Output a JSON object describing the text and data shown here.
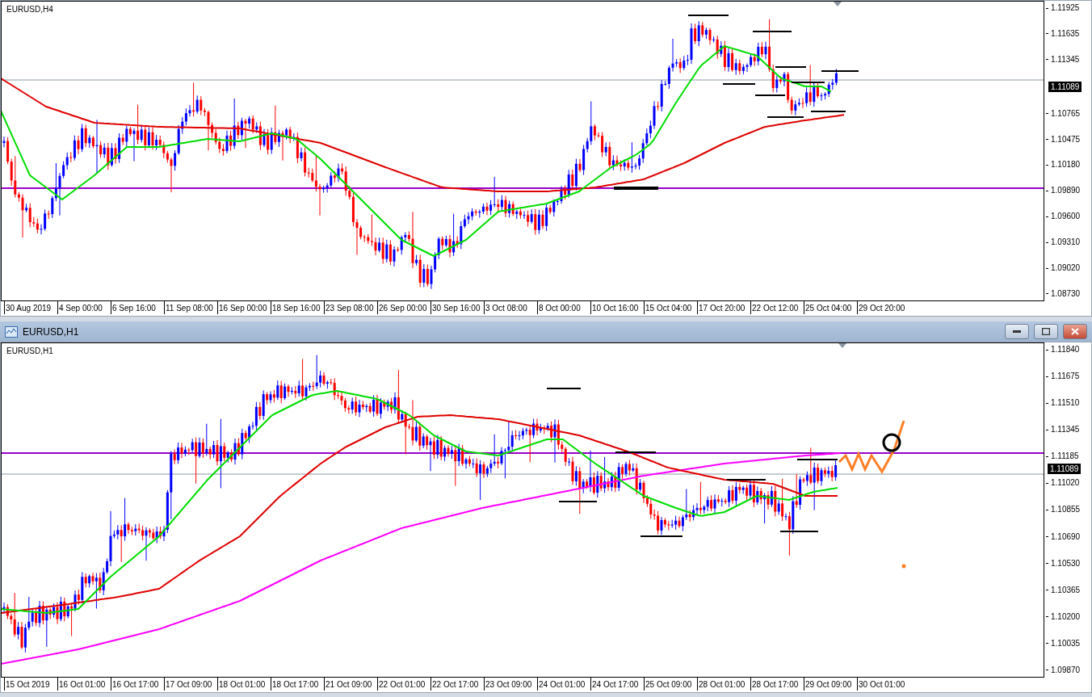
{
  "top_chart": {
    "label": "EURUSD,H4",
    "price_ticks": [
      "1.11925",
      "1.11635",
      "1.11345",
      "1.10765",
      "1.10475",
      "1.10180",
      "1.09890",
      "1.09600",
      "1.09310",
      "1.09020",
      "1.08730"
    ],
    "current_price": "1.11089",
    "time_labels": [
      "30 Aug 2019",
      "4 Sep 00:00",
      "6 Sep 16:00",
      "11 Sep 08:00",
      "16 Sep 00:00",
      "18 Sep 16:00",
      "23 Sep 08:00",
      "26 Sep 00:00",
      "30 Sep 16:00",
      "3 Oct 08:00",
      "8 Oct 00:00",
      "10 Oct 16:00",
      "15 Oct 04:00",
      "17 Oct 20:00",
      "22 Oct 12:00",
      "25 Oct 04:00",
      "29 Oct 20:00"
    ]
  },
  "bottom_window": {
    "title": "EURUSD,H1",
    "chart": {
      "label": "EURUSD,H1",
      "price_ticks": [
        "1.11840",
        "1.11675",
        "1.11510",
        "1.11345",
        "1.11185",
        "1.11020",
        "1.10855",
        "1.10690",
        "1.10530",
        "1.10365",
        "1.10200",
        "1.10035",
        "1.09870"
      ],
      "current_price": "1.11089",
      "time_labels": [
        "15 Oct 2019",
        "16 Oct 01:00",
        "16 Oct 17:00",
        "17 Oct 09:00",
        "18 Oct 01:00",
        "18 Oct 17:00",
        "21 Oct 09:00",
        "22 Oct 01:00",
        "22 Oct 17:00",
        "23 Oct 09:00",
        "24 Oct 01:00",
        "24 Oct 17:00",
        "25 Oct 09:00",
        "28 Oct 01:00",
        "28 Oct 17:00",
        "29 Oct 09:00",
        "30 Oct 01:00"
      ]
    }
  }
}
